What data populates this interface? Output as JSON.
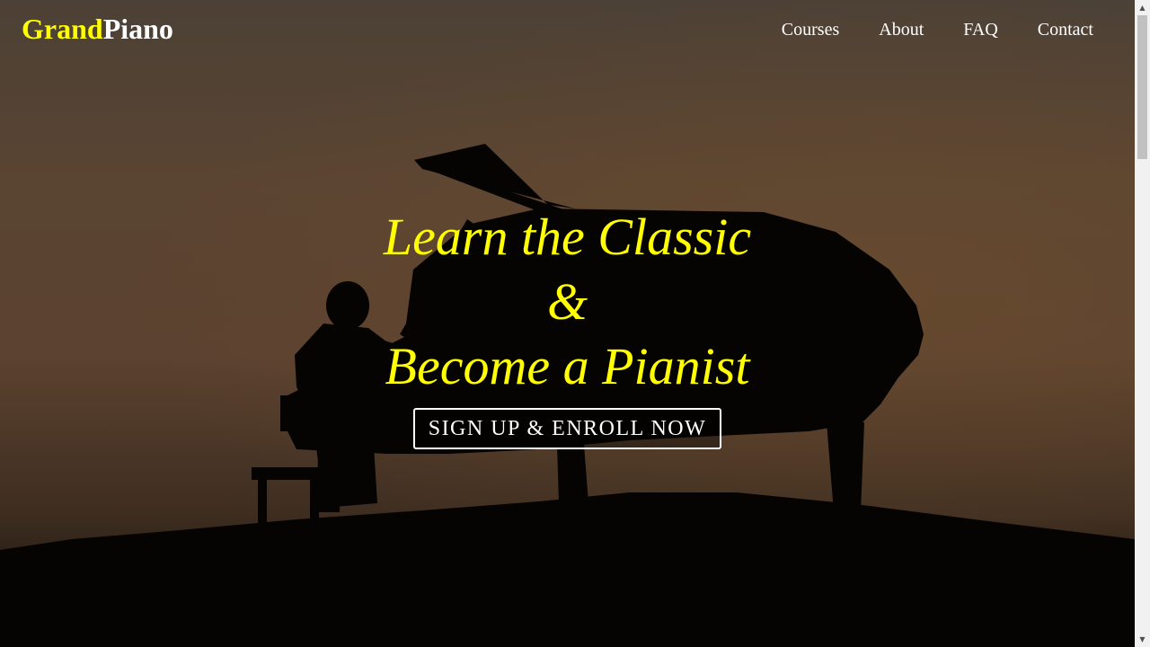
{
  "brand": {
    "part1": "Grand",
    "part2": "Piano"
  },
  "nav": {
    "items": [
      {
        "label": "Courses"
      },
      {
        "label": "About"
      },
      {
        "label": "FAQ"
      },
      {
        "label": "Contact"
      }
    ]
  },
  "hero": {
    "line1": "Learn the Classic",
    "line2": "&",
    "line3": "Become a Pianist",
    "cta_label": "SIGN UP & ENROLL NOW"
  },
  "scrollbar": {
    "up_icon": "chevron-up-icon",
    "down_icon": "chevron-down-icon"
  },
  "colors": {
    "accent": "#ffff00",
    "text": "#ffffff"
  }
}
